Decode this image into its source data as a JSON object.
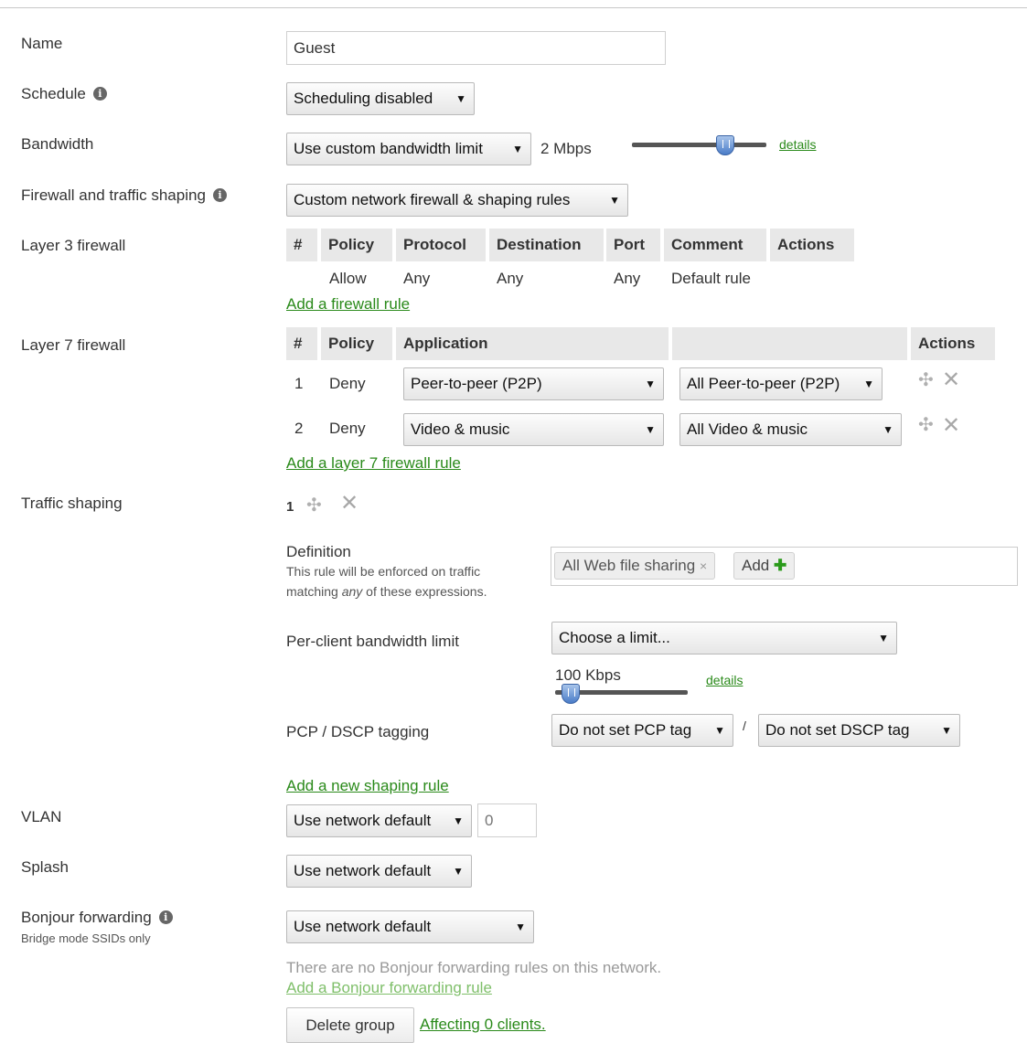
{
  "fields": {
    "name": {
      "label": "Name",
      "value": "Guest"
    },
    "schedule": {
      "label": "Schedule",
      "value": "Scheduling disabled"
    },
    "bandwidth": {
      "label": "Bandwidth",
      "value": "Use custom bandwidth limit",
      "limit_text": "2 Mbps",
      "details_link": "details"
    },
    "firewall": {
      "label": "Firewall and traffic shaping",
      "value": "Custom network firewall & shaping rules"
    }
  },
  "layer3": {
    "label": "Layer 3 firewall",
    "headers": [
      "#",
      "Policy",
      "Protocol",
      "Destination",
      "Port",
      "Comment",
      "Actions"
    ],
    "rows": [
      {
        "num": "",
        "policy": "Allow",
        "protocol": "Any",
        "destination": "Any",
        "port": "Any",
        "comment": "Default rule"
      }
    ],
    "add_link": "Add a firewall rule"
  },
  "layer7": {
    "label": "Layer 7 firewall",
    "headers": {
      "num": "#",
      "policy": "Policy",
      "application": "Application",
      "actions": "Actions"
    },
    "rows": [
      {
        "num": "1",
        "policy": "Deny",
        "category": "Peer-to-peer (P2P)",
        "app": "All Peer-to-peer (P2P)"
      },
      {
        "num": "2",
        "policy": "Deny",
        "category": "Video & music",
        "app": "All Video & music"
      }
    ],
    "add_link": "Add a layer 7 firewall rule"
  },
  "traffic_shaping": {
    "label": "Traffic shaping",
    "rule_number": "1",
    "definition_label": "Definition",
    "definition_help_1": "This rule will be enforced on traffic",
    "definition_help_2_pre": "matching ",
    "definition_help_2_em": "any",
    "definition_help_2_post": " of these expressions.",
    "tags": [
      "All Web file sharing"
    ],
    "add_tag_label": "Add",
    "per_client_label": "Per-client bandwidth limit",
    "per_client_value": "Choose a limit...",
    "per_client_limit_text": "100 Kbps",
    "per_client_details": "details",
    "pcp_label": "PCP / DSCP tagging",
    "pcp_value": "Do not set PCP tag",
    "separator": "/",
    "dscp_value": "Do not set DSCP tag",
    "add_link": "Add a new shaping rule"
  },
  "vlan": {
    "label": "VLAN",
    "value": "Use network default",
    "placeholder": "0"
  },
  "splash": {
    "label": "Splash",
    "value": "Use network default"
  },
  "bonjour": {
    "label": "Bonjour forwarding",
    "sublabel": "Bridge mode SSIDs only",
    "value": "Use network default",
    "empty_text": "There are no Bonjour forwarding rules on this network.",
    "add_link": "Add a Bonjour forwarding rule"
  },
  "footer": {
    "delete_button": "Delete group",
    "affecting_link": "Affecting 0 clients."
  },
  "icons": {
    "caret": "▼",
    "info": "i",
    "remove": "✕",
    "move": "✣",
    "plus": "✚",
    "tag_remove": "×"
  },
  "colors": {
    "link": "#2a8a1a",
    "header_bg": "#e8e8e8",
    "plus": "#2a9a1a"
  }
}
